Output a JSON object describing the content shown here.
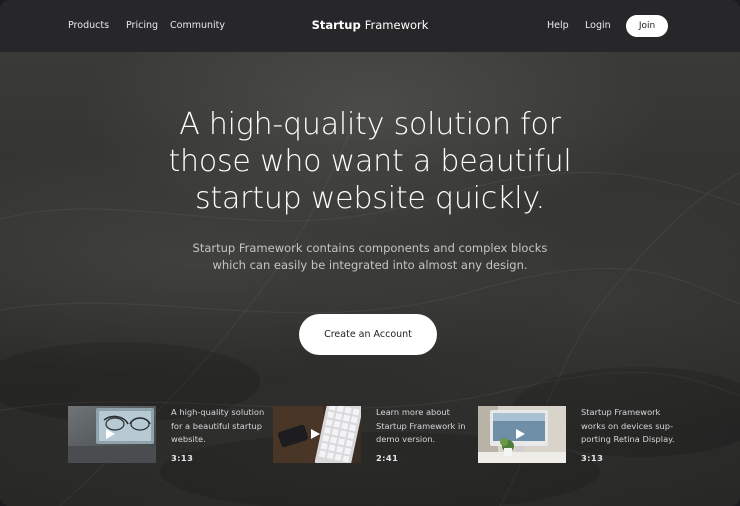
{
  "header": {
    "nav_left": [
      "Products",
      "Pricing",
      "Community"
    ],
    "brand_bold": "Startup",
    "brand_rest": "Framework",
    "nav_right": [
      "Help",
      "Login"
    ],
    "join_label": "Join"
  },
  "hero": {
    "title_lines": [
      "A high-quality solution for",
      "those who want a beautiful",
      "startup website quickly."
    ],
    "subtitle_lines": [
      "Startup Framework contains components and complex blocks",
      "which can easily be integrated into almost any design."
    ],
    "cta_label": "Create an Account"
  },
  "videos": [
    {
      "desc_lines": [
        "A high-quality solution",
        "for a beautiful startup",
        "website."
      ],
      "duration": "3:13",
      "thumb": "glasses-on-laptop"
    },
    {
      "desc_lines": [
        "Learn more about",
        "Startup Framework in",
        "demo version."
      ],
      "duration": "2:41",
      "thumb": "phone-and-keyboard"
    },
    {
      "desc_lines": [
        "Startup Framework",
        "works on devices sup-",
        "porting Retina Display."
      ],
      "duration": "3:13",
      "thumb": "imac-on-desk"
    }
  ],
  "icons": {
    "play": "play-icon"
  },
  "colors": {
    "header_bg": "#272729",
    "button_bg": "#ffffff",
    "button_text": "#222222"
  }
}
